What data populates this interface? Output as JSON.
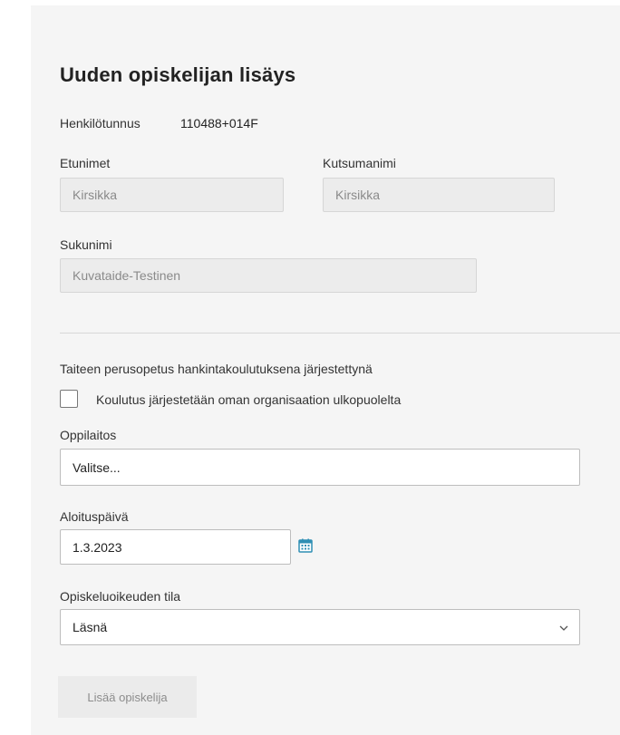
{
  "form": {
    "title": "Uuden opiskelijan lisäys",
    "hetu_label": "Henkilötunnus",
    "hetu_value": "110488+014F",
    "etunimet_label": "Etunimet",
    "etunimet_value": "Kirsikka",
    "kutsumanimi_label": "Kutsumanimi",
    "kutsumanimi_value": "Kirsikka",
    "sukunimi_label": "Sukunimi",
    "sukunimi_value": "Kuvataide-Testinen",
    "section_label": "Taiteen perusopetus hankintakoulutuksena järjestettynä",
    "checkbox_label": "Koulutus järjestetään oman organisaation ulkopuolelta",
    "checkbox_checked": false,
    "oppilaitos_label": "Oppilaitos",
    "oppilaitos_placeholder": "Valitse...",
    "aloituspaiva_label": "Aloituspäivä",
    "aloituspaiva_value": "1.3.2023",
    "tila_label": "Opiskeluoikeuden tila",
    "tila_value": "Läsnä",
    "submit_label": "Lisää opiskelija"
  },
  "icons": {
    "calendar": "calendar-icon",
    "dropdown": "chevron-down-icon"
  },
  "colors": {
    "accent": "#2f8fb4",
    "panel_bg": "#f5f5f5",
    "disabled_bg": "#ececec"
  }
}
